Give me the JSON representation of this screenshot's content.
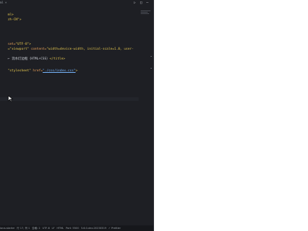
{
  "editor": {
    "tab_title": "ml ×",
    "lines": {
      "l1": "ml>",
      "l2_attr": "zh-CN",
      "l3_attr": "set=",
      "l3_val": "\"UTF-8\"",
      "l4a": "=\"viewport\"",
      "l4b": "content=",
      "l4c": "\"width=device-width, initial-scale=1.0, user-",
      "l5a": "← 流水灯边框（HTML+CSS）",
      "l5b": "</title>",
      "l6a": "\"stylesheet\"",
      "l6b": "href=",
      "l6c": "\"./css/index.css\"",
      "l6d": ">"
    }
  },
  "status_bar": {
    "left": "iona-starter",
    "line_col": "行 17, 列 1",
    "spaces": "空格: 2",
    "encoding": "UTF-8",
    "eol": "LF",
    "language": "HTML",
    "port": "Port: 5500",
    "version": "5.6.0-dev.20230319",
    "prettier": "✓ Prettier"
  },
  "icons": {
    "run": "play-icon",
    "split": "split-icon",
    "more": "more-icon"
  }
}
